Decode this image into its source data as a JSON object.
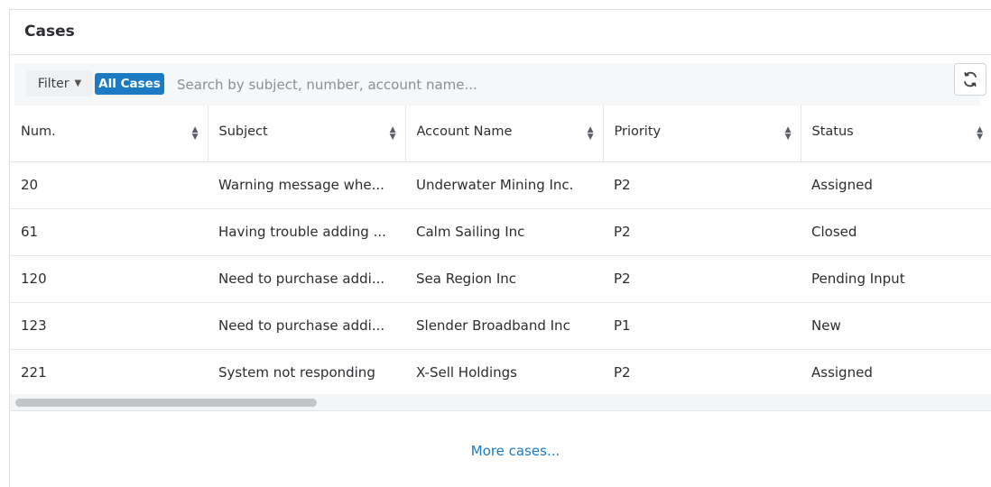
{
  "panel": {
    "title": "Cases"
  },
  "toolbar": {
    "filter_label": "Filter",
    "all_cases_label": "All Cases",
    "search_placeholder": "Search by subject, number, account name..."
  },
  "table": {
    "columns": [
      "Num.",
      "Subject",
      "Account Name",
      "Priority",
      "Status"
    ],
    "rows": [
      {
        "num": "20",
        "subject": "Warning message whe...",
        "account": "Underwater Mining Inc.",
        "priority": "P2",
        "status": "Assigned"
      },
      {
        "num": "61",
        "subject": "Having trouble adding ...",
        "account": "Calm Sailing Inc",
        "priority": "P2",
        "status": "Closed"
      },
      {
        "num": "120",
        "subject": "Need to purchase addi...",
        "account": "Sea Region Inc",
        "priority": "P2",
        "status": "Pending Input"
      },
      {
        "num": "123",
        "subject": "Need to purchase addi...",
        "account": "Slender Broadband Inc",
        "priority": "P1",
        "status": "New"
      },
      {
        "num": "221",
        "subject": "System not responding",
        "account": "X-Sell Holdings",
        "priority": "P2",
        "status": "Assigned"
      }
    ]
  },
  "footer": {
    "more_label": "More cases..."
  },
  "colors": {
    "accent": "#1b7ac2",
    "border": "#e3e5e8"
  }
}
